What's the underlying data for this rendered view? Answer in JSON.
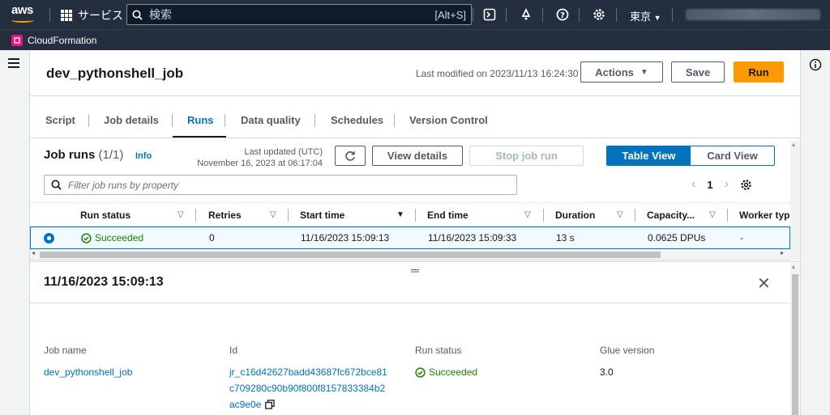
{
  "topbar": {
    "logo": "aws",
    "services_label": "サービス",
    "search_placeholder": "検索",
    "search_shortcut": "[Alt+S]",
    "region": "東京"
  },
  "subbar": {
    "service_name": "CloudFormation"
  },
  "header": {
    "job_name": "dev_pythonshell_job",
    "last_modified": "Last modified on 2023/11/13 16:24:30",
    "actions_label": "Actions",
    "save_label": "Save",
    "run_label": "Run"
  },
  "tabs": [
    {
      "label": "Script"
    },
    {
      "label": "Job details"
    },
    {
      "label": "Runs"
    },
    {
      "label": "Data quality"
    },
    {
      "label": "Schedules"
    },
    {
      "label": "Version Control"
    }
  ],
  "runs": {
    "title": "Job runs",
    "count": "(1/1)",
    "info": "Info",
    "last_updated_label": "Last updated (UTC)",
    "last_updated_value": "November 16, 2023 at 06:17:04",
    "view_details": "View details",
    "stop_job_run": "Stop job run",
    "table_view": "Table View",
    "card_view": "Card View",
    "filter_placeholder": "Filter job runs by property",
    "page": "1",
    "columns": [
      "Run status",
      "Retries",
      "Start time",
      "End time",
      "Duration",
      "Capacity...",
      "Worker typ"
    ],
    "rows": [
      {
        "status": "Succeeded",
        "retries": "0",
        "start": "11/16/2023 15:09:13",
        "end": "11/16/2023 15:09:33",
        "duration": "13 s",
        "capacity": "0.0625 DPUs",
        "worker": "-"
      }
    ]
  },
  "detail": {
    "title": "11/16/2023 15:09:13",
    "job_name_label": "Job name",
    "job_name_value": "dev_pythonshell_job",
    "id_label": "Id",
    "id_line1": "jr_c16d42627badd43687fc672bce81",
    "id_line2": "c709280c90b90f800f8157833384b2",
    "id_line3": "ac9e0e",
    "run_status_label": "Run status",
    "run_status_value": "Succeeded",
    "glue_version_label": "Glue version",
    "glue_version_value": "3.0"
  },
  "colors": {
    "accent": "#0073bb",
    "run_button": "#ff9900",
    "success": "#1d8102",
    "nav_bg": "#232f3e"
  }
}
